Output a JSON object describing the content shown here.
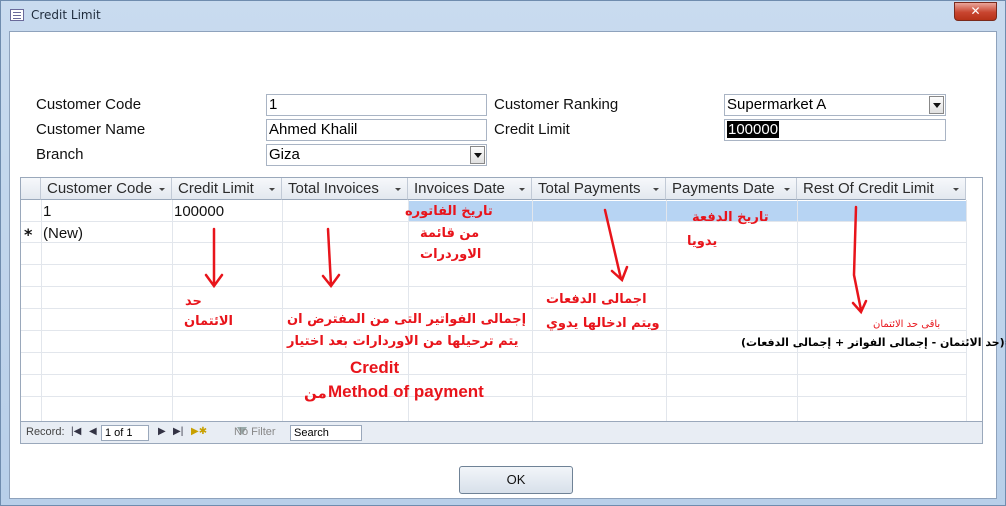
{
  "window": {
    "title": "Credit Limit",
    "close_glyph": "✕"
  },
  "form": {
    "customer_code": {
      "label": "Customer Code",
      "value": "1"
    },
    "customer_name": {
      "label": "Customer Name",
      "value": "Ahmed Khalil"
    },
    "branch": {
      "label": "Branch",
      "value": "Giza"
    },
    "customer_ranking": {
      "label": "Customer Ranking",
      "value": "Supermarket A"
    },
    "credit_limit": {
      "label": "Credit Limit",
      "value": "100000"
    }
  },
  "grid": {
    "columns": [
      "Customer Code",
      "Credit Limit",
      "Total Invoices",
      "Invoices Date",
      "Total Payments",
      "Payments Date",
      "Rest Of Credit Limit"
    ],
    "rows": [
      {
        "customer_code": "1",
        "credit_limit": "100000"
      }
    ],
    "new_row_label": "(New)",
    "new_row_marker": "*"
  },
  "nav": {
    "record_label": "Record:",
    "position": "1 of 1",
    "no_filter": "No Filter",
    "search": "Search"
  },
  "annotations": {
    "invoice_date_1": "تاريخ الفاتوره",
    "invoice_date_2": "من قائمة",
    "invoice_date_3": "الاوردرات",
    "payments_date_1": "تاريخ الدفعة",
    "payments_date_2": "يدويا",
    "credit_1": "حد",
    "credit_2": "الائتمان",
    "invoices_1": "إجمالى الفواتير التى من المفترض ان",
    "invoices_2": "يتم ترحيلها من الاوردارات بعد اختيار",
    "invoices_3": "Credit",
    "invoices_4": "Method of payment",
    "invoices_5": "من",
    "payments_1": "اجمالى الدفعات",
    "payments_2": "ويتم ادخالها يدوي",
    "rest_1": "باقى حد الائتمان",
    "rest_2": "=(حد الائتمان - إجمالى الفواتر + إجمالى الدفعات)"
  },
  "buttons": {
    "ok": "OK"
  }
}
